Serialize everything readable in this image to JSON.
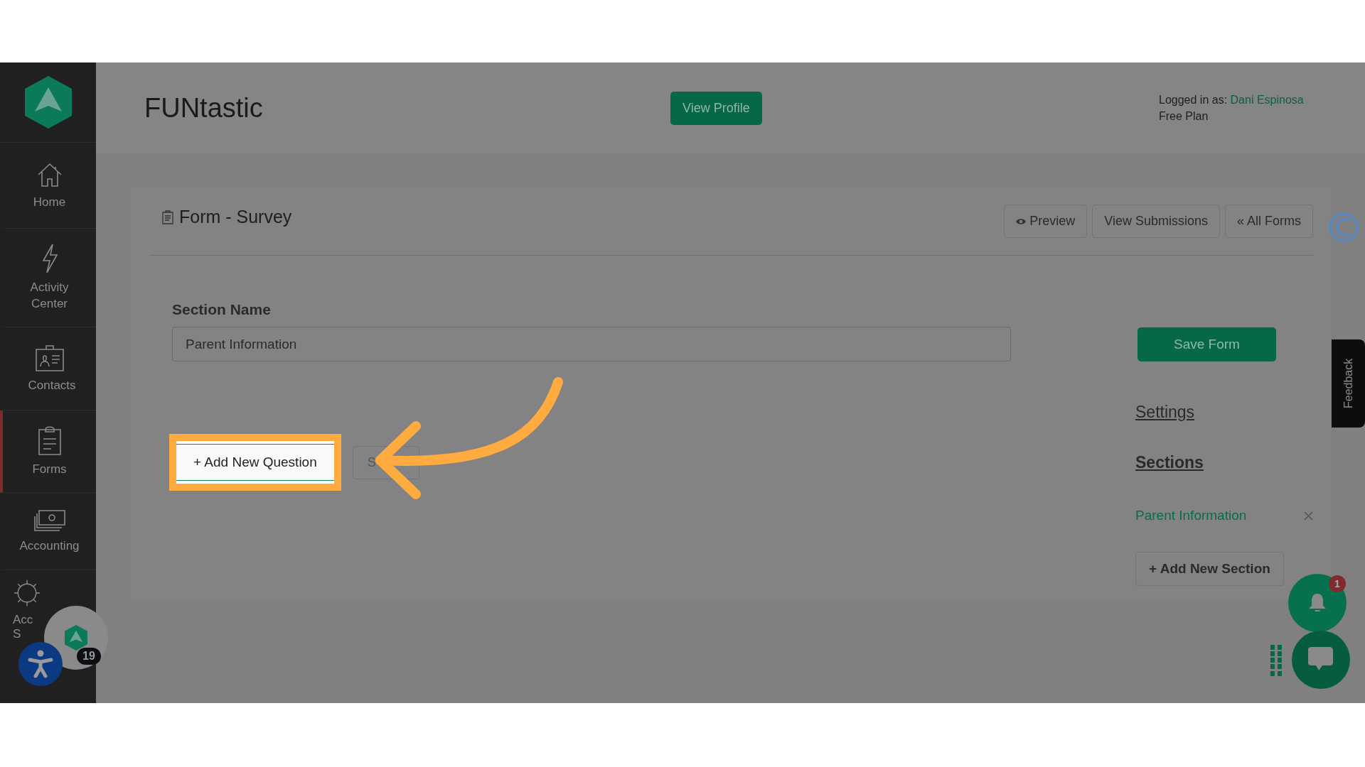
{
  "sidebar": {
    "items": [
      {
        "label": "Home",
        "selected": false
      },
      {
        "label": "Activity Center",
        "selected": false
      },
      {
        "label": "Contacts",
        "selected": false
      },
      {
        "label": "Forms",
        "selected": true
      },
      {
        "label": "Accounting",
        "selected": false
      },
      {
        "label": "Acc S",
        "selected": false
      }
    ]
  },
  "header": {
    "title": "FUNtastic",
    "view_profile": "View Profile",
    "logged_in_label": "Logged in as:",
    "user_name": "Dani Espinosa",
    "plan": "Free Plan"
  },
  "form": {
    "title": "Form - Survey",
    "actions": [
      {
        "label": "Preview",
        "kind": "preview"
      },
      {
        "label": "View Submissions",
        "kind": "plain"
      },
      {
        "label": "« All Forms",
        "kind": "plain"
      }
    ],
    "section_name_label": "Section Name",
    "section_name_value": "Parent Information",
    "add_question": "+ Add New Question",
    "second_button": "S"
  },
  "side_panel": {
    "save": "Save Form",
    "settings": "Settings",
    "sections_heading": "Sections",
    "sections": [
      {
        "name": "Parent Information"
      }
    ],
    "add_section": "+ Add New Section"
  },
  "feedback": "Feedback",
  "notification_count": "1",
  "widget_badge": "19"
}
